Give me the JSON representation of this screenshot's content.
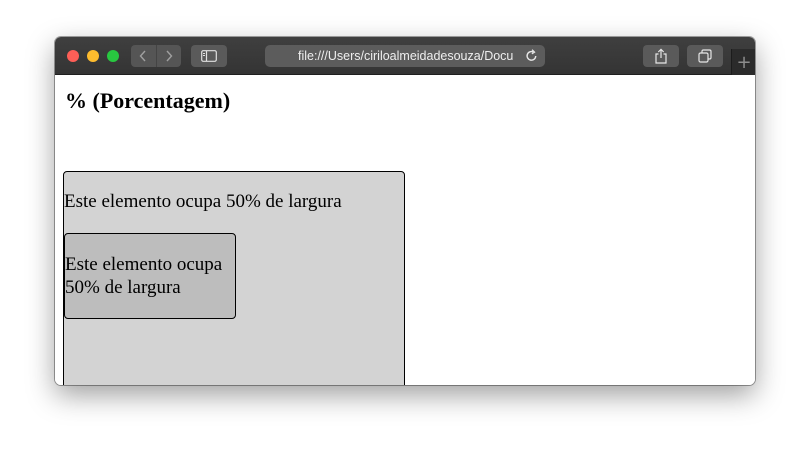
{
  "browser": {
    "address": "file:///Users/ciriloalmeidadesouza/Docu",
    "icons": {
      "back": "chevron-left-icon",
      "forward": "chevron-right-icon",
      "sidebar": "sidebar-icon",
      "reload": "reload-icon",
      "share": "share-icon",
      "tabs": "tabs-icon",
      "new_tab": "plus-icon"
    }
  },
  "page": {
    "title": "% (Porcentagem)",
    "outer_text": "Este elemento ocupa 50% de largura",
    "inner_text": "Este elemento ocupa 50% de largura"
  },
  "colors": {
    "outer_box": "#d3d3d3",
    "inner_box": "#bdbdbd",
    "titlebar": "#3a3a3a"
  }
}
